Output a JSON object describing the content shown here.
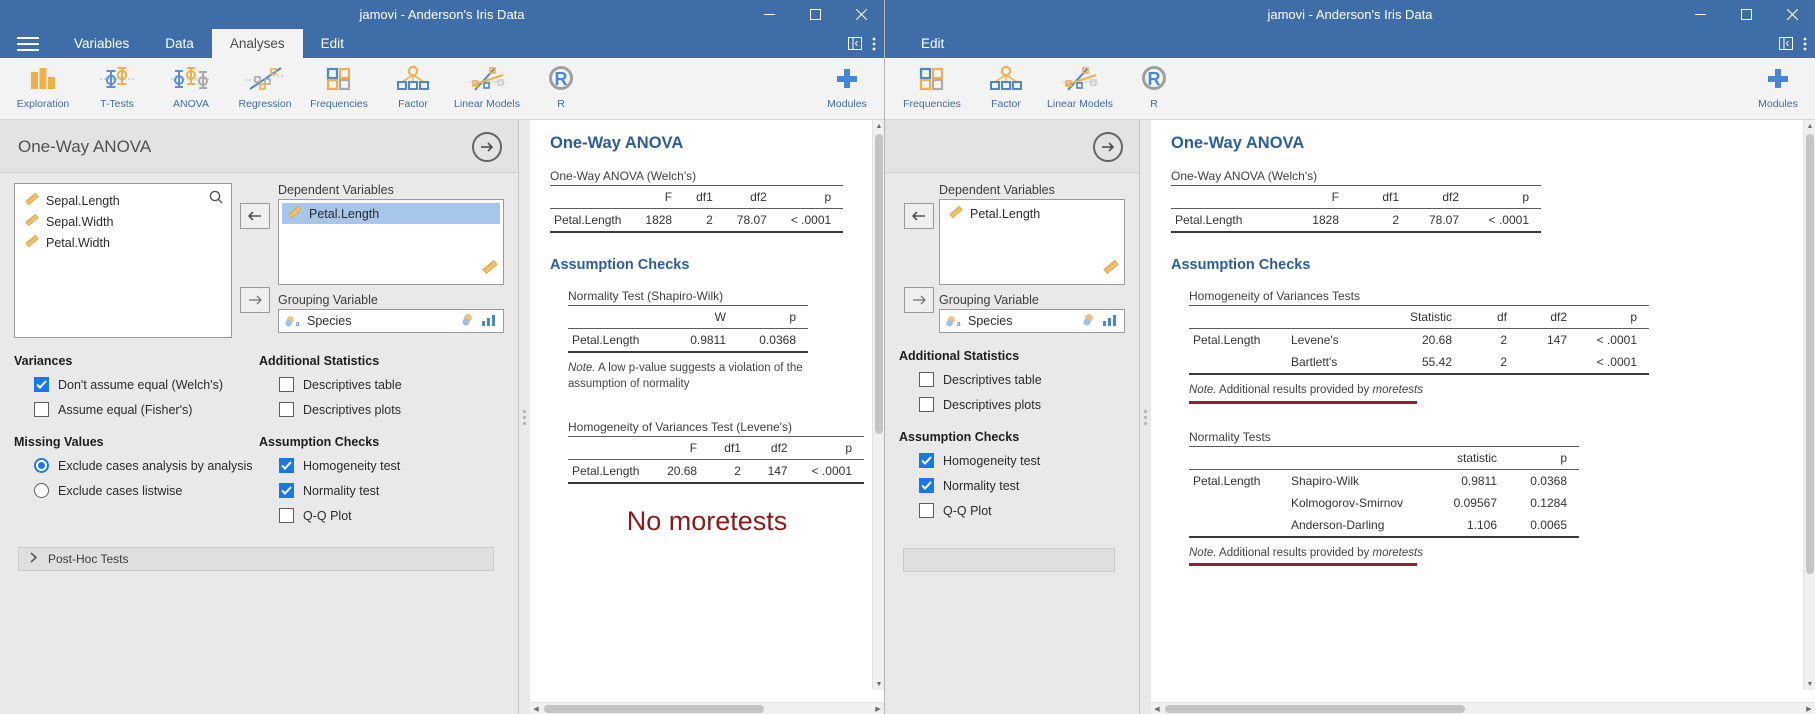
{
  "windows": [
    {
      "id": "left",
      "title": "jamovi - Anderson's Iris Data",
      "tabs": [
        {
          "label": "Variables",
          "active": false
        },
        {
          "label": "Data",
          "active": false
        },
        {
          "label": "Analyses",
          "active": true
        },
        {
          "label": "Edit",
          "active": false
        }
      ],
      "ribbon": [
        {
          "label": "Exploration",
          "icon": "exploration-icon"
        },
        {
          "label": "T-Tests",
          "icon": "t-tests-icon"
        },
        {
          "label": "ANOVA",
          "icon": "anova-icon"
        },
        {
          "label": "Regression",
          "icon": "regression-icon"
        },
        {
          "label": "Frequencies",
          "icon": "frequencies-icon"
        },
        {
          "label": "Factor",
          "icon": "factor-icon"
        },
        {
          "label": "Linear Models",
          "icon": "linear-models-icon"
        },
        {
          "label": "R",
          "icon": "r-icon"
        }
      ],
      "modules_label": "Modules",
      "options": {
        "title": "One-Way ANOVA",
        "available_variables": [
          "Sepal.Length",
          "Sepal.Width",
          "Petal.Width"
        ],
        "dependent_label": "Dependent Variables",
        "dependent_variables": [
          "Petal.Length"
        ],
        "grouping_label": "Grouping Variable",
        "grouping_variable": "Species",
        "groups": [
          {
            "header": "Variances",
            "type": "checkbox",
            "items": [
              {
                "label": "Don't assume equal (Welch's)",
                "checked": true
              },
              {
                "label": "Assume equal (Fisher's)",
                "checked": false
              }
            ]
          },
          {
            "header": "Additional Statistics",
            "type": "checkbox",
            "items": [
              {
                "label": "Descriptives table",
                "checked": false
              },
              {
                "label": "Descriptives plots",
                "checked": false
              }
            ]
          },
          {
            "header": "Missing Values",
            "type": "radio",
            "items": [
              {
                "label": "Exclude cases analysis by analysis",
                "checked": true
              },
              {
                "label": "Exclude cases listwise",
                "checked": false
              }
            ]
          },
          {
            "header": "Assumption Checks",
            "type": "checkbox",
            "items": [
              {
                "label": "Homogeneity test",
                "checked": true
              },
              {
                "label": "Normality test",
                "checked": true
              },
              {
                "label": "Q-Q Plot",
                "checked": false
              }
            ]
          }
        ],
        "posthoc_label": "Post-Hoc Tests"
      },
      "results": {
        "h1": "One-Way ANOVA",
        "anova": {
          "caption": "One-Way ANOVA (Welch's)",
          "columns": [
            "",
            "F",
            "df1",
            "df2",
            "p"
          ],
          "rows": [
            [
              "Petal.Length",
              "1828",
              "2",
              "78.07",
              "< .0001"
            ]
          ]
        },
        "h2": "Assumption Checks",
        "normality": {
          "caption": "Normality Test (Shapiro-Wilk)",
          "columns": [
            "",
            "W",
            "p"
          ],
          "rows": [
            [
              "Petal.Length",
              "0.9811",
              "0.0368"
            ]
          ],
          "note_prefix": "Note.",
          "note": " A low p-value suggests a violation of the assumption of normality"
        },
        "levene": {
          "caption": "Homogeneity of Variances Test (Levene's)",
          "columns": [
            "",
            "F",
            "df1",
            "df2",
            "p"
          ],
          "rows": [
            [
              "Petal.Length",
              "20.68",
              "2",
              "147",
              "< .0001"
            ]
          ]
        },
        "no_more_tests": "No moretests"
      }
    },
    {
      "id": "right",
      "title": "jamovi - Anderson's Iris Data",
      "tabs": [
        {
          "label": "Edit",
          "active": false
        }
      ],
      "ribbon": [
        {
          "label": "Frequencies",
          "icon": "frequencies-icon"
        },
        {
          "label": "Factor",
          "icon": "factor-icon"
        },
        {
          "label": "Linear Models",
          "icon": "linear-models-icon"
        },
        {
          "label": "R",
          "icon": "r-icon"
        }
      ],
      "modules_label": "Modules",
      "options": {
        "title": "",
        "dependent_label": "Dependent Variables",
        "dependent_variables": [
          "Petal.Length"
        ],
        "grouping_label": "Grouping Variable",
        "grouping_variable": "Species",
        "groups": [
          {
            "header": "Additional Statistics",
            "type": "checkbox",
            "items": [
              {
                "label": "Descriptives table",
                "checked": false
              },
              {
                "label": "Descriptives plots",
                "checked": false
              }
            ]
          },
          {
            "header": "Assumption Checks",
            "type": "checkbox",
            "items": [
              {
                "label": "Homogeneity test",
                "checked": true
              },
              {
                "label": "Normality test",
                "checked": true
              },
              {
                "label": "Q-Q Plot",
                "checked": false
              }
            ]
          }
        ]
      },
      "results": {
        "h1": "One-Way ANOVA",
        "anova": {
          "caption": "One-Way ANOVA (Welch's)",
          "columns": [
            "",
            "F",
            "df1",
            "df2",
            "p"
          ],
          "rows": [
            [
              "Petal.Length",
              "1828",
              "2",
              "78.07",
              "< .0001"
            ]
          ]
        },
        "h2": "Assumption Checks",
        "homogeneity": {
          "caption": "Homogeneity of Variances Tests",
          "columns": [
            "",
            "",
            "Statistic",
            "df",
            "df2",
            "p"
          ],
          "rows": [
            [
              "Petal.Length",
              "Levene's",
              "20.68",
              "2",
              "147",
              "< .0001"
            ],
            [
              "",
              "Bartlett's",
              "55.42",
              "2",
              "",
              "< .0001"
            ]
          ],
          "note_prefix": "Note.",
          "note": " Additional results provided by ",
          "note_em": "moretests"
        },
        "normality": {
          "caption": "Normality Tests",
          "columns": [
            "",
            "",
            "statistic",
            "p"
          ],
          "rows": [
            [
              "Petal.Length",
              "Shapiro-Wilk",
              "0.9811",
              "0.0368"
            ],
            [
              "",
              "Kolmogorov-Smirnov",
              "0.09567",
              "0.1284"
            ],
            [
              "",
              "Anderson-Darling",
              "1.106",
              "0.0065"
            ]
          ],
          "note_prefix": "Note.",
          "note": " Additional results provided by ",
          "note_em": "moretests"
        }
      }
    }
  ],
  "colors": {
    "titlebar": "#3e6da8",
    "accent_blue": "#2c5d9b",
    "checkbox_blue": "#1978e5",
    "highlight_row": "#a8c6ea",
    "note_red": "#9b1b30",
    "no_more_red": "#8c1a1a",
    "icon_orange": "#eeb049"
  },
  "icons": {
    "hamburger": "hamburger-icon",
    "minimize": "minimize-icon",
    "maximize": "maximize-icon",
    "close": "close-icon",
    "search": "search-icon",
    "arrow_left": "arrow-left-icon",
    "arrow_right": "arrow-right-icon",
    "arrow_circle_right": "arrow-circle-right-icon",
    "chevron_right": "chevron-right-icon",
    "ruler": "continuous-variable-icon",
    "nominal": "nominal-variable-icon",
    "plus": "plus-icon"
  }
}
